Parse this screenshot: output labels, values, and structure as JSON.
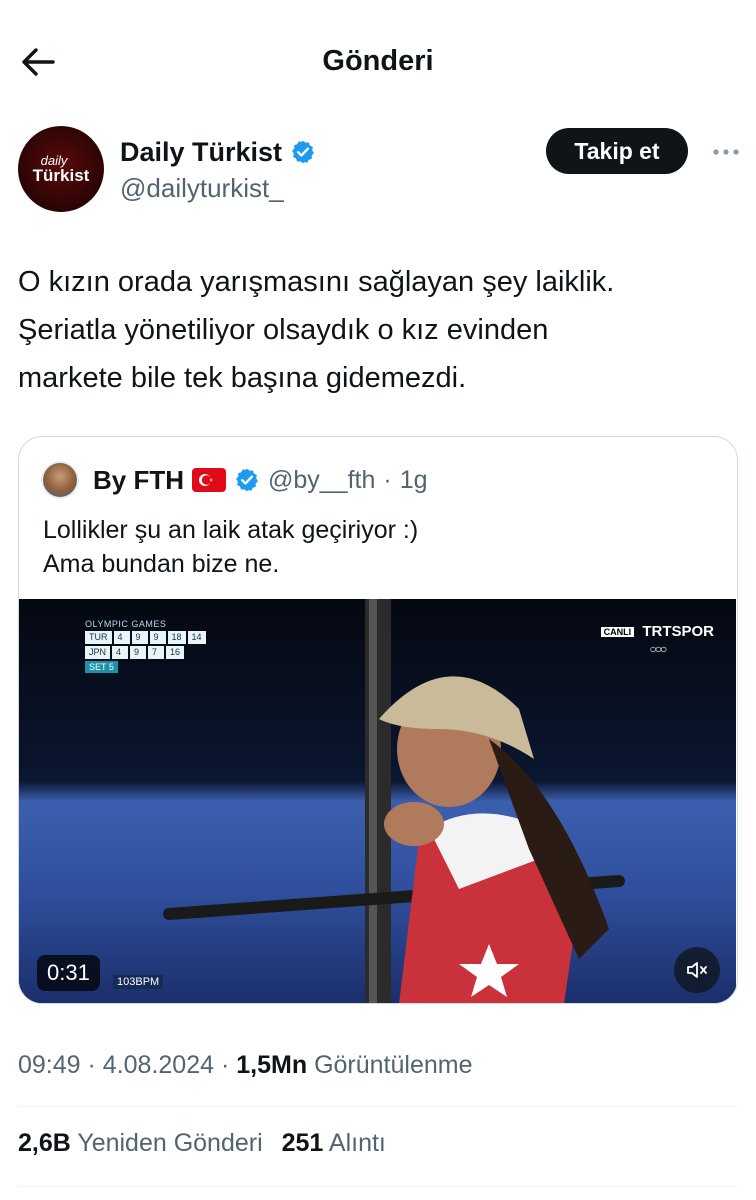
{
  "header": {
    "title": "Gönderi",
    "back_icon": "arrow-left-icon"
  },
  "author": {
    "name": "Daily Türkist",
    "handle": "@dailyturkist_",
    "avatar_text_top": "daily",
    "avatar_text_bottom": "Türkist",
    "verified": true,
    "follow_label": "Takip et",
    "more_icon": "more-horizontal-icon"
  },
  "tweet": {
    "lines": [
      "O kızın orada yarışmasını sağlayan şey laiklik.",
      "Şeriatla yönetiliyor olsaydık o kız evinden",
      "markete bile tek başına gidemezdi."
    ]
  },
  "quote": {
    "name": "By FTH",
    "handle": "@by__fth",
    "separator": "·",
    "time": "1g",
    "flag": "turkey-flag-icon",
    "lines": [
      "Lollikler şu an laik atak geçiriyor :)",
      "Ama bundan bize ne."
    ],
    "video": {
      "duration": "0:31",
      "broadcaster": "TRTSPOR",
      "live_badge": "CANLI",
      "bpm": "103BPM",
      "scoreboard": {
        "title": "OLYMPIC GAMES",
        "rows": [
          {
            "team": "TUR",
            "a": "4",
            "b": "9",
            "c": "9",
            "d": "18",
            "e": "14"
          },
          {
            "team": "JPN",
            "a": "4",
            "b": "9",
            "c": "7",
            "d": "16",
            "e": ""
          }
        ],
        "set": "SET 5"
      },
      "mute_icon": "volume-muted-icon"
    }
  },
  "meta": {
    "time": "09:49",
    "date": "4.08.2024",
    "views_count": "1,5Mn",
    "views_label": "Görüntülenme"
  },
  "stats": {
    "reposts_count": "2,6B",
    "reposts_label": "Yeniden Gönderi",
    "quotes_count": "251",
    "quotes_label": "Alıntı"
  },
  "colors": {
    "text": "#0f1419",
    "muted": "#536471",
    "verified": "#1d9bf0",
    "border": "#cfd9de"
  }
}
